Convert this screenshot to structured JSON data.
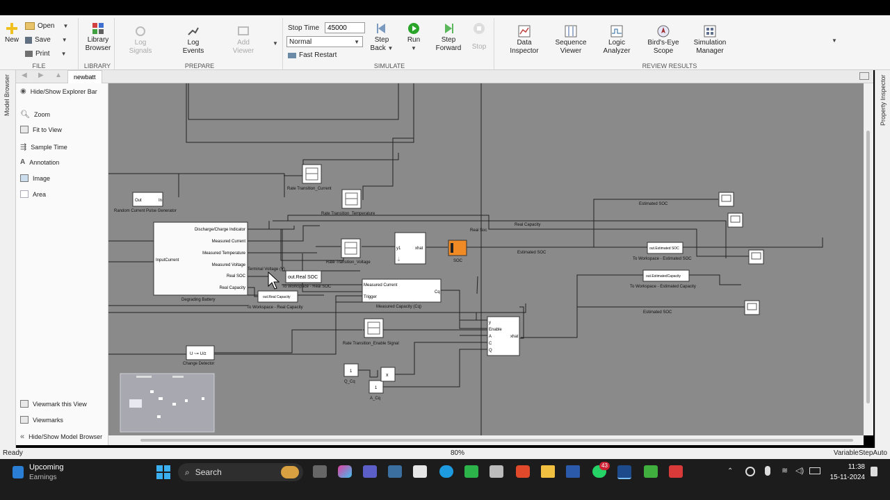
{
  "ribbon": {
    "file": {
      "label": "FILE",
      "new": "New",
      "open": "Open",
      "save": "Save",
      "print": "Print"
    },
    "library": {
      "label": "LIBRARY",
      "browser_line1": "Library",
      "browser_line2": "Browser"
    },
    "prepare": {
      "label": "PREPARE",
      "log_signals_1": "Log",
      "log_signals_2": "Signals",
      "log_events_1": "Log",
      "log_events_2": "Events",
      "add_viewer_1": "Add",
      "add_viewer_2": "Viewer"
    },
    "simulate": {
      "label": "SIMULATE",
      "stop_time_label": "Stop Time",
      "stop_time_value": "45000",
      "mode": "Normal",
      "fast_restart": "Fast Restart",
      "step_back_1": "Step",
      "step_back_2": "Back",
      "run": "Run",
      "step_forward_1": "Step",
      "step_forward_2": "Forward",
      "stop": "Stop"
    },
    "review": {
      "label": "REVIEW RESULTS",
      "data_inspector_1": "Data",
      "data_inspector_2": "Inspector",
      "sequence_viewer_1": "Sequence",
      "sequence_viewer_2": "Viewer",
      "logic_analyzer_1": "Logic",
      "logic_analyzer_2": "Analyzer",
      "birds_eye_1": "Bird's-Eye",
      "birds_eye_2": "Scope",
      "sim_manager_1": "Simulation",
      "sim_manager_2": "Manager"
    }
  },
  "side": {
    "model_browser": "Model Browser",
    "property_inspector": "Property Inspector"
  },
  "tab": {
    "name": "newbatt"
  },
  "explorer": {
    "hide_show_explorer": "Hide/Show Explorer Bar",
    "zoom": "Zoom",
    "fit_to_view": "Fit to View",
    "sample_time": "Sample Time",
    "annotation": "Annotation",
    "image": "Image",
    "area": "Area",
    "viewmark_this": "Viewmark this View",
    "viewmarks": "Viewmarks",
    "hide_show_model": "Hide/Show Model Browser"
  },
  "diagram": {
    "pulse_out": "Out",
    "pulse_in": "In",
    "pulse_name": "Random Current Pulse Generator",
    "battery_input": "InputCurrent",
    "battery_ports": [
      "Discharge/Charge Indicator",
      "Measured Current",
      "Measured Temperature",
      "Measured Voltage",
      "Real SOC",
      "Real Capacity"
    ],
    "battery_name": "Degrading Battery",
    "rt_current": "Rate Transition_Current",
    "rt_temp": "Rate Transition_Temperature",
    "rt_voltage": "Rate Transition_Voltage",
    "rt_enable": "Rate Transition_Enable Signal",
    "terminal_voltage": "Terminal Voltage (V)",
    "ws_real_soc_block": "out.Real SOC",
    "ws_real_soc_name": "To Workspace - Real SOC",
    "ws_real_cap_block": "out.Real Capacity",
    "ws_real_cap_name": "To Workspace - Real Capacity",
    "ekf_y1": "y1",
    "ekf_xhat": "xhat",
    "soc_name": "SOC",
    "mc_in1": "Measured Current",
    "mc_in2": "Trigger",
    "mc_out": "Cq",
    "mc_name": "Measured Capacity (Cq)",
    "kf_ports": [
      "y",
      "Enable",
      "A",
      "C",
      "Q"
    ],
    "kf_out": "xhat",
    "cd_block": "U ~= U/z",
    "cd_name": "Change Detector",
    "const_q": "1",
    "const_q_name": "Q_Cq",
    "const_a": "1",
    "const_a_name": "A_Cq",
    "mult": "x",
    "label_estimated_soc_top": "Estimated SOC",
    "label_real_capacity": "Real Capacity",
    "label_real_soc": "Real Soc",
    "label_estimated_soc_mid": "Estimated SOC",
    "label_estimated_soc_bot": "Estimated SOC",
    "ws_est_soc_block": "out.Estimated SOC",
    "ws_est_soc_name": "To Workspace - Estimated SOC",
    "ws_est_cap_block": "out.EstimatedCapacity",
    "ws_est_cap_name": "To Workspace - Estimated Capacity"
  },
  "status": {
    "left": "Ready",
    "zoom": "80%",
    "solver": "VariableStepAuto"
  },
  "taskbar": {
    "weather_title": "Upcoming",
    "weather_sub": "Earnings",
    "search": "Search",
    "badge": "43",
    "time": "11:38",
    "date": "15-11-2024"
  },
  "colors": {
    "soc_block": "#f08a24",
    "canvas": "#8a8a8a",
    "run_green": "#2aa52a"
  }
}
